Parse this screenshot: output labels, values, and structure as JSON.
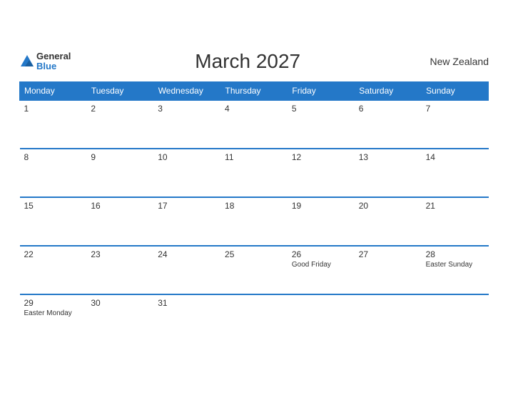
{
  "header": {
    "logo_general": "General",
    "logo_blue": "Blue",
    "title": "March 2027",
    "country": "New Zealand"
  },
  "weekdays": [
    "Monday",
    "Tuesday",
    "Wednesday",
    "Thursday",
    "Friday",
    "Saturday",
    "Sunday"
  ],
  "weeks": [
    [
      {
        "day": "1",
        "event": ""
      },
      {
        "day": "2",
        "event": ""
      },
      {
        "day": "3",
        "event": ""
      },
      {
        "day": "4",
        "event": ""
      },
      {
        "day": "5",
        "event": ""
      },
      {
        "day": "6",
        "event": ""
      },
      {
        "day": "7",
        "event": ""
      }
    ],
    [
      {
        "day": "8",
        "event": ""
      },
      {
        "day": "9",
        "event": ""
      },
      {
        "day": "10",
        "event": ""
      },
      {
        "day": "11",
        "event": ""
      },
      {
        "day": "12",
        "event": ""
      },
      {
        "day": "13",
        "event": ""
      },
      {
        "day": "14",
        "event": ""
      }
    ],
    [
      {
        "day": "15",
        "event": ""
      },
      {
        "day": "16",
        "event": ""
      },
      {
        "day": "17",
        "event": ""
      },
      {
        "day": "18",
        "event": ""
      },
      {
        "day": "19",
        "event": ""
      },
      {
        "day": "20",
        "event": ""
      },
      {
        "day": "21",
        "event": ""
      }
    ],
    [
      {
        "day": "22",
        "event": ""
      },
      {
        "day": "23",
        "event": ""
      },
      {
        "day": "24",
        "event": ""
      },
      {
        "day": "25",
        "event": ""
      },
      {
        "day": "26",
        "event": "Good Friday"
      },
      {
        "day": "27",
        "event": ""
      },
      {
        "day": "28",
        "event": "Easter Sunday"
      }
    ],
    [
      {
        "day": "29",
        "event": "Easter Monday"
      },
      {
        "day": "30",
        "event": ""
      },
      {
        "day": "31",
        "event": ""
      },
      {
        "day": "",
        "event": ""
      },
      {
        "day": "",
        "event": ""
      },
      {
        "day": "",
        "event": ""
      },
      {
        "day": "",
        "event": ""
      }
    ]
  ]
}
